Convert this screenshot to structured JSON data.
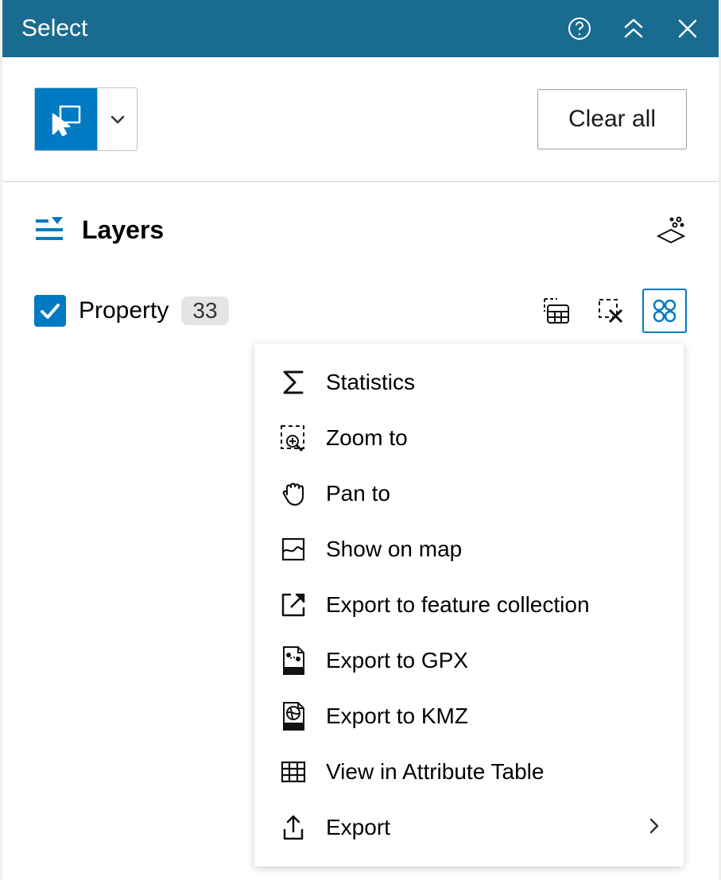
{
  "header": {
    "title": "Select"
  },
  "toolbar": {
    "clear_label": "Clear all"
  },
  "layers": {
    "heading": "Layers",
    "items": [
      {
        "name": "Property",
        "count": "33",
        "checked": true
      }
    ]
  },
  "menu": {
    "items": [
      {
        "label": "Statistics"
      },
      {
        "label": "Zoom to"
      },
      {
        "label": "Pan to"
      },
      {
        "label": "Show on map"
      },
      {
        "label": "Export to feature collection"
      },
      {
        "label": "Export to GPX"
      },
      {
        "label": "Export to KMZ"
      },
      {
        "label": "View in Attribute Table"
      },
      {
        "label": "Export",
        "has_submenu": true
      }
    ]
  }
}
